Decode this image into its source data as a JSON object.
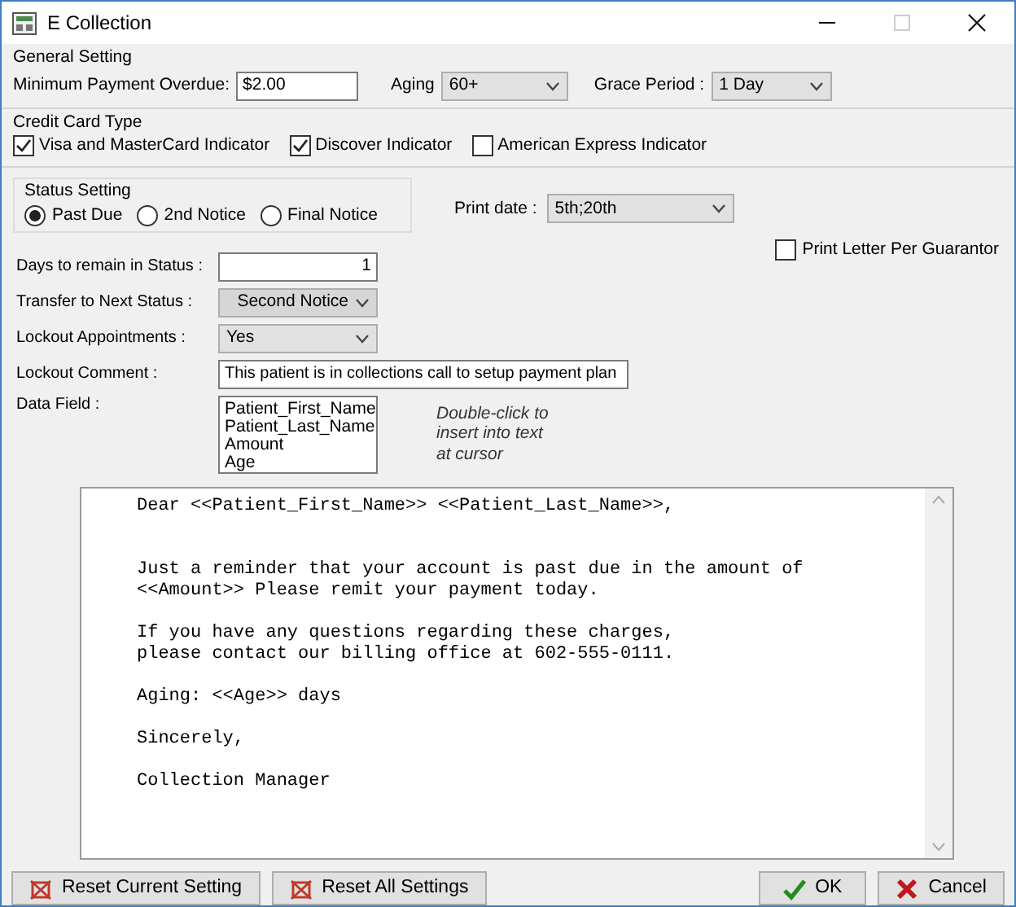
{
  "window": {
    "title": "E Collection"
  },
  "general_setting": {
    "title": "General Setting",
    "minimum_payment_label": "Minimum Payment Overdue:",
    "minimum_payment_value": "$2.00",
    "aging_label": "Aging",
    "aging_value": "60+",
    "grace_period_label": "Grace Period :",
    "grace_period_value": "1 Day"
  },
  "credit_card_type": {
    "title": "Credit Card Type",
    "options": [
      {
        "label": "Visa and MasterCard Indicator",
        "checked": true
      },
      {
        "label": "Discover Indicator",
        "checked": true
      },
      {
        "label": "American Express Indicator",
        "checked": false
      }
    ]
  },
  "status_setting": {
    "title": "Status Setting",
    "options": [
      {
        "label": "Past Due",
        "selected": true
      },
      {
        "label": "2nd Notice",
        "selected": false
      },
      {
        "label": "Final Notice",
        "selected": false
      }
    ]
  },
  "print_date": {
    "label": "Print date :",
    "value": "5th;20th"
  },
  "print_letter_per_guarantor": {
    "label": "Print Letter Per Guarantor",
    "checked": false
  },
  "fields": [
    {
      "kind": "number",
      "label": "Days to remain in Status :",
      "value": "1"
    },
    {
      "kind": "dropdown",
      "label": "Transfer to Next Status :",
      "value": "Second Notice",
      "disabled": true
    },
    {
      "kind": "dropdown",
      "label": "Lockout Appointments :",
      "value": "Yes",
      "disabled": false
    },
    {
      "kind": "wide_text",
      "label": "Lockout Comment :",
      "value": "This patient is in collections call  to setup payment plan"
    },
    {
      "kind": "list",
      "label": "Data Field :",
      "items": [
        "Patient_First_Name",
        "Patient_Last_Name",
        "Amount",
        "Age"
      ],
      "hint": "Double-click to insert into text at cursor"
    }
  ],
  "letter": {
    "text": "Dear <<Patient_First_Name>> <<Patient_Last_Name>>,\n\n\nJust a reminder that your account is past due in the amount of\n<<Amount>> Please remit your payment today.\n\nIf you have any questions regarding these charges,\nplease contact our billing office at 602-555-0111.\n\nAging: <<Age>> days\n\nSincerely,\n\nCollection Manager"
  },
  "buttons": [
    {
      "kind": "reset",
      "label": "Reset Current Setting"
    },
    {
      "kind": "reset",
      "label": "Reset All Settings"
    },
    {
      "kind": "ok",
      "label": "OK"
    },
    {
      "kind": "cancel",
      "label": "Cancel"
    }
  ]
}
